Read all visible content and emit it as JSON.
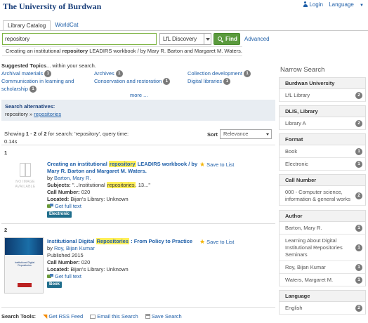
{
  "header": {
    "brand": "The University of Burdwan",
    "login_label": "Login",
    "language_label": "Language"
  },
  "tabs": [
    {
      "label": "Library Catalog",
      "active": true
    },
    {
      "label": "WorldCat",
      "active": false
    }
  ],
  "search": {
    "query": "repository",
    "scope": "LfL Discovery",
    "find_label": "Find",
    "advanced_label": "Advanced"
  },
  "record_banner": {
    "prefix": "Creating an institutional ",
    "highlight": "repository",
    "suffix": " LEADIRS workbook / by Mary R. Barton and Margaret M. Waters."
  },
  "suggested_topics": {
    "heading": "Suggested Topics",
    "heading_suffix": "... within your search.",
    "col1": [
      {
        "label": "Archival materials",
        "count": "1"
      },
      {
        "label": "Communication in learning and",
        "count": ""
      },
      {
        "label": "scholarship",
        "count": "1"
      }
    ],
    "col2": [
      {
        "label": "Archives",
        "count": "1"
      },
      {
        "label": "Conservation and restoration",
        "count": "1"
      }
    ],
    "col3": [
      {
        "label": "Collection development",
        "count": "1"
      },
      {
        "label": "Digital libraries",
        "count": "1"
      }
    ],
    "more_label": "more ..."
  },
  "alternatives": {
    "heading": "Search alternatives",
    "from": "repository",
    "arrow": "»",
    "to": "repositories"
  },
  "summary": {
    "text_prefix": "Showing ",
    "start": "1",
    "dash": " - ",
    "end": "2",
    "of": " of ",
    "total": "2",
    "text_suffix": " for search: 'repository', query time: 0.14s",
    "sort_label": "Sort",
    "sort_value": "Relevance"
  },
  "results": [
    {
      "num": "1",
      "title_prefix": "Creating an institutional ",
      "title_highlight": "repository",
      "title_suffix": " LEADIRS workbook / by Mary R. Barton and Margaret M. Waters.",
      "by_label": "by ",
      "author": "Barton, Mary R.",
      "subjects_label": "Subjects:",
      "subjects_prefix": " \"...Institutional ",
      "subjects_highlight": "repositories",
      "subjects_suffix": ". 13...\"",
      "call_label": "Call Number:",
      "call_value": " 020",
      "located_label": "Located:",
      "located_value": " Bijan's Library: Unknown",
      "fulltext_label": "Get full text",
      "format": "Electronic",
      "save_label": "Save to List",
      "no_cover_text": "NO IMAGE AVAILABLE"
    },
    {
      "num": "2",
      "title_prefix": "Institutional Digital ",
      "title_highlight": "Repositories",
      "title_suffix": " : From Policy to Practice",
      "by_label": "by ",
      "author": "Roy, Bijan Kumar",
      "published": "Published 2015",
      "call_label": "Call Number:",
      "call_value": " 020",
      "located_label": "Located:",
      "located_value": " Bijan's Library: Unknown",
      "fulltext_label": "Get full text",
      "format": "Book",
      "save_label": "Save to List",
      "cover_title": "Institutional Digital Repositories"
    }
  ],
  "search_tools": {
    "label": "Search Tools:",
    "rss": "Get RSS Feed",
    "email": "Email this Search",
    "save": "Save Search"
  },
  "sidebar": {
    "heading": "Narrow Search",
    "facets": [
      {
        "title": "Burdwan University",
        "items": [
          {
            "label": "LfL Library",
            "count": "2"
          }
        ]
      },
      {
        "title": "DLIS, Library",
        "items": [
          {
            "label": "Library A",
            "count": "2"
          }
        ]
      },
      {
        "title": "Format",
        "items": [
          {
            "label": "Book",
            "count": "1"
          },
          {
            "label": "Electronic",
            "count": "1"
          }
        ]
      },
      {
        "title": "Call Number",
        "items": [
          {
            "label": "000 - Computer science, information & general works",
            "count": "2"
          }
        ]
      },
      {
        "title": "Author",
        "items": [
          {
            "label": "Barton, Mary R.",
            "count": "1"
          },
          {
            "label": "Learning About Digital Institutional Repositories Seminars",
            "count": "1"
          },
          {
            "label": "Roy, Bijan Kumar",
            "count": "1"
          },
          {
            "label": "Waters, Margaret M.",
            "count": "1"
          }
        ]
      },
      {
        "title": "Language",
        "items": [
          {
            "label": "English",
            "count": "2"
          }
        ]
      }
    ]
  },
  "colors": {
    "brand": "#1a3f7a",
    "link": "#1f5fa8",
    "find_button": "#5a9a3d",
    "highlight": "#ffee58"
  }
}
